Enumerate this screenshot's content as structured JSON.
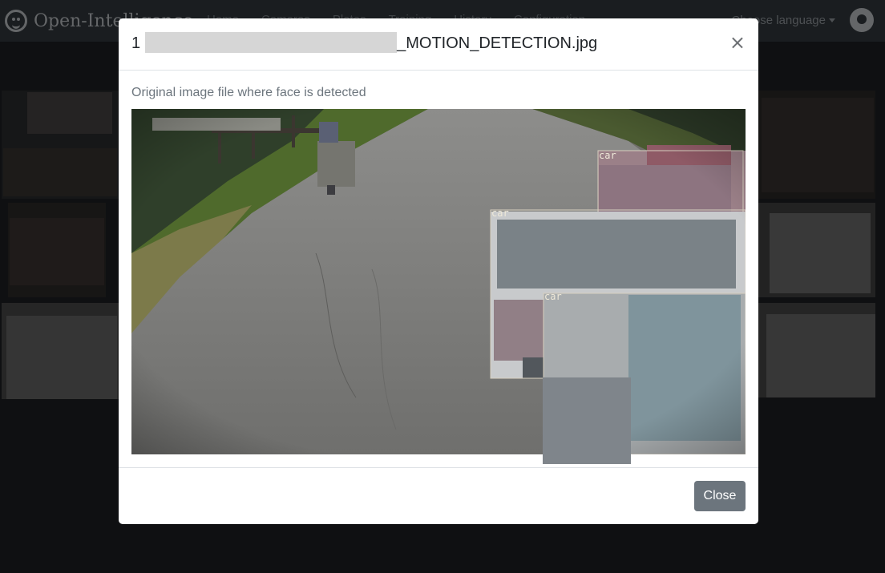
{
  "navbar": {
    "brand": "Open-Intelligence",
    "links": [
      "Home",
      "Cameras",
      "Plates",
      "Training",
      "History",
      "Configuration"
    ],
    "choose_language": "Choose language"
  },
  "modal": {
    "title_prefix": "1",
    "title_suffix": "_MOTION_DETECTION.jpg",
    "close_symbol": "×",
    "caption": "Original image file where face is detected",
    "close_button": "Close"
  },
  "detections": [
    {
      "label": "car"
    },
    {
      "label": "car"
    },
    {
      "label": "car"
    }
  ],
  "colors": {
    "button_secondary": "#6c757d",
    "navbar_bg": "#343a40",
    "box_outline": "#d8d0c0"
  }
}
